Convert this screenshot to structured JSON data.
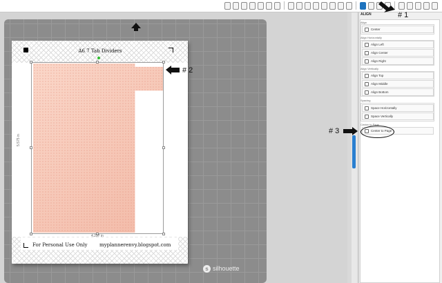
{
  "toolbar": {
    "icons": [
      "grid-view-icon",
      "page-setup-icon",
      "design-store-icon",
      "library-icon",
      "sketch-icon",
      "registration-icon",
      "fill-icon",
      "line-icon",
      "offset-icon",
      "trace-icon",
      "pixscan-icon",
      "text-style-icon",
      "send-icon",
      "replicate-icon",
      "modify-icon",
      "align-icon",
      "transform-icon",
      "knife-icon",
      "select-icon",
      "print-icon",
      "shape-icon",
      "store-icon",
      "layers-icon",
      "cut-settings-icon"
    ]
  },
  "page": {
    "title": "A6 7 Tab Dividers",
    "footer_left": "For Personal Use Only",
    "footer_right": "myplannerenvy.blogspot.com",
    "width_label": "4.237 in",
    "height_label": "5.575 in"
  },
  "mat": {
    "brand": "silhouette"
  },
  "panel": {
    "title": "ALIGN",
    "sections": [
      {
        "heading": "Align",
        "options": [
          "Center"
        ]
      },
      {
        "heading": "Align Horizontally",
        "options": [
          "Align Left",
          "Align Center",
          "Align Right"
        ]
      },
      {
        "heading": "Align Vertically",
        "options": [
          "Align Top",
          "Align Middle",
          "Align Bottom"
        ]
      },
      {
        "heading": "Spacing",
        "options": [
          "Space Horizontally",
          "Space Vertically"
        ]
      },
      {
        "heading": "Center to Page",
        "options": [
          "Center to Page"
        ]
      }
    ]
  },
  "callouts": {
    "one": "# 1",
    "two": "# 2",
    "three": "# 3"
  },
  "colors": {
    "accent": "#1e73be",
    "divider_fill": "#f6c8b6",
    "mat": "#8c8c8c",
    "rotate_handle": "#2ebd2e"
  }
}
